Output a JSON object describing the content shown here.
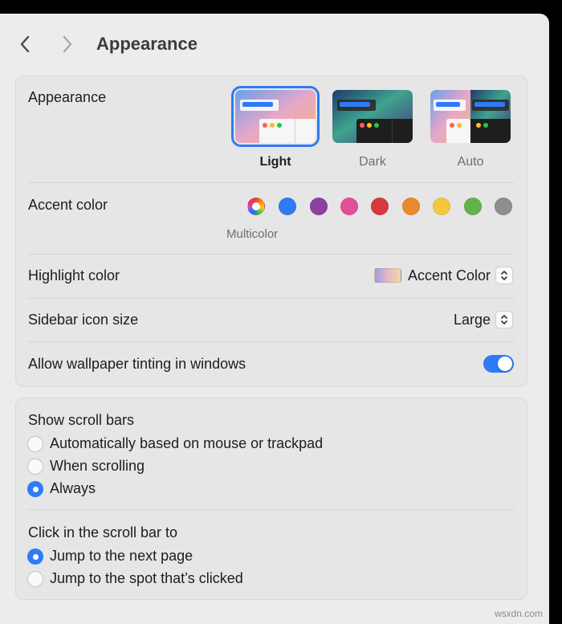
{
  "toolbar": {
    "title": "Appearance",
    "back_icon": "chevron-left-icon",
    "forward_icon": "chevron-right-icon"
  },
  "appearance": {
    "label": "Appearance",
    "options": [
      {
        "label": "Light",
        "selected": true
      },
      {
        "label": "Dark",
        "selected": false
      },
      {
        "label": "Auto",
        "selected": false
      }
    ]
  },
  "accent": {
    "label": "Accent color",
    "selected_label": "Multicolor",
    "colors": [
      "multicolor",
      "#2f7bf5",
      "#8e3fa0",
      "#e0519a",
      "#d8393c",
      "#ea8a2e",
      "#f5c73d",
      "#63b34c",
      "#8e8e8e"
    ]
  },
  "highlight": {
    "label": "Highlight color",
    "value": "Accent Color"
  },
  "sidebar_icon_size": {
    "label": "Sidebar icon size",
    "value": "Large"
  },
  "wallpaper_tinting": {
    "label": "Allow wallpaper tinting in windows",
    "enabled": true
  },
  "scroll_bars": {
    "label": "Show scroll bars",
    "options": [
      {
        "label": "Automatically based on mouse or trackpad",
        "selected": false
      },
      {
        "label": "When scrolling",
        "selected": false
      },
      {
        "label": "Always",
        "selected": true
      }
    ]
  },
  "click_scroll": {
    "label": "Click in the scroll bar to",
    "options": [
      {
        "label": "Jump to the next page",
        "selected": true
      },
      {
        "label": "Jump to the spot that’s clicked",
        "selected": false
      }
    ]
  },
  "watermark": "wsxdn.com"
}
